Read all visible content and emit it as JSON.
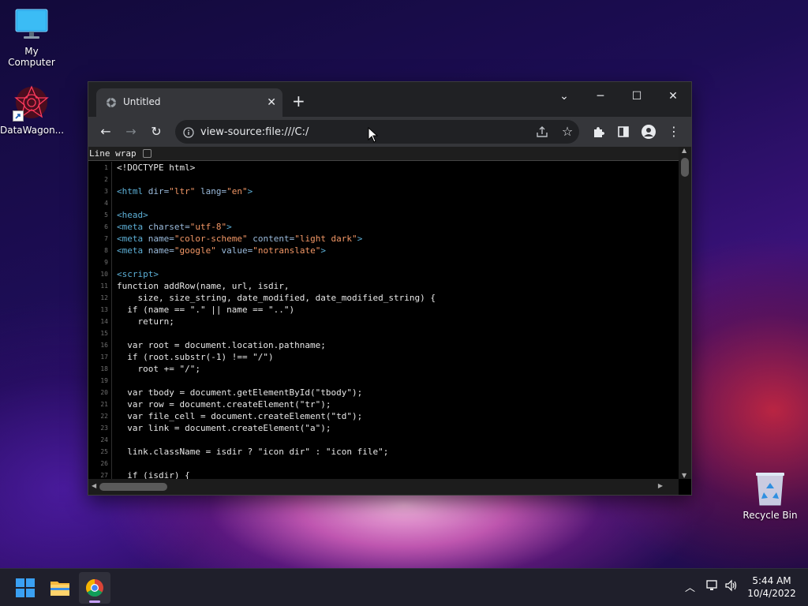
{
  "desktop": {
    "icons": [
      {
        "label": "My Computer",
        "icon": "monitor-icon"
      },
      {
        "label": "DataWagon...",
        "icon": "datawagon-icon"
      },
      {
        "label": "Recycle Bin",
        "icon": "recycle-bin-icon"
      }
    ]
  },
  "browser": {
    "tab": {
      "title": "Untitled",
      "icon": "globe-icon"
    },
    "address_bar": {
      "url": "view-source:file:///C:/"
    },
    "view_source": {
      "line_wrap_label": "Line wrap",
      "line_wrap_checked": false,
      "lines": [
        {
          "n": "1",
          "segments": [
            {
              "t": "<!DOCTYPE html>",
              "c": "plain"
            }
          ]
        },
        {
          "n": "2",
          "segments": []
        },
        {
          "n": "3",
          "segments": [
            {
              "t": "<html ",
              "c": "tag"
            },
            {
              "t": "dir=",
              "c": "attr"
            },
            {
              "t": "\"ltr\"",
              "c": "val"
            },
            {
              "t": " lang=",
              "c": "attr"
            },
            {
              "t": "\"en\"",
              "c": "val"
            },
            {
              "t": ">",
              "c": "tag"
            }
          ]
        },
        {
          "n": "4",
          "segments": []
        },
        {
          "n": "5",
          "segments": [
            {
              "t": "<head>",
              "c": "tag"
            }
          ]
        },
        {
          "n": "6",
          "segments": [
            {
              "t": "<meta ",
              "c": "tag"
            },
            {
              "t": "charset=",
              "c": "attr"
            },
            {
              "t": "\"utf-8\"",
              "c": "val"
            },
            {
              "t": ">",
              "c": "tag"
            }
          ]
        },
        {
          "n": "7",
          "segments": [
            {
              "t": "<meta ",
              "c": "tag"
            },
            {
              "t": "name=",
              "c": "attr"
            },
            {
              "t": "\"color-scheme\"",
              "c": "val"
            },
            {
              "t": " content=",
              "c": "attr"
            },
            {
              "t": "\"light dark\"",
              "c": "val"
            },
            {
              "t": ">",
              "c": "tag"
            }
          ]
        },
        {
          "n": "8",
          "segments": [
            {
              "t": "<meta ",
              "c": "tag"
            },
            {
              "t": "name=",
              "c": "attr"
            },
            {
              "t": "\"google\"",
              "c": "val"
            },
            {
              "t": " value=",
              "c": "attr"
            },
            {
              "t": "\"notranslate\"",
              "c": "val"
            },
            {
              "t": ">",
              "c": "tag"
            }
          ]
        },
        {
          "n": "9",
          "segments": []
        },
        {
          "n": "10",
          "segments": [
            {
              "t": "<script>",
              "c": "tag"
            }
          ]
        },
        {
          "n": "11",
          "segments": [
            {
              "t": "function addRow(name, url, isdir,",
              "c": "plain"
            }
          ]
        },
        {
          "n": "12",
          "segments": [
            {
              "t": "    size, size_string, date_modified, date_modified_string) {",
              "c": "plain"
            }
          ]
        },
        {
          "n": "13",
          "segments": [
            {
              "t": "  if (name == \".\" || name == \"..\")",
              "c": "plain"
            }
          ]
        },
        {
          "n": "14",
          "segments": [
            {
              "t": "    return;",
              "c": "plain"
            }
          ]
        },
        {
          "n": "15",
          "segments": []
        },
        {
          "n": "16",
          "segments": [
            {
              "t": "  var root = document.location.pathname;",
              "c": "plain"
            }
          ]
        },
        {
          "n": "17",
          "segments": [
            {
              "t": "  if (root.substr(-1) !== \"/\")",
              "c": "plain"
            }
          ]
        },
        {
          "n": "18",
          "segments": [
            {
              "t": "    root += \"/\";",
              "c": "plain"
            }
          ]
        },
        {
          "n": "19",
          "segments": []
        },
        {
          "n": "20",
          "segments": [
            {
              "t": "  var tbody = document.getElementById(\"tbody\");",
              "c": "plain"
            }
          ]
        },
        {
          "n": "21",
          "segments": [
            {
              "t": "  var row = document.createElement(\"tr\");",
              "c": "plain"
            }
          ]
        },
        {
          "n": "22",
          "segments": [
            {
              "t": "  var file_cell = document.createElement(\"td\");",
              "c": "plain"
            }
          ]
        },
        {
          "n": "23",
          "segments": [
            {
              "t": "  var link = document.createElement(\"a\");",
              "c": "plain"
            }
          ]
        },
        {
          "n": "24",
          "segments": []
        },
        {
          "n": "25",
          "segments": [
            {
              "t": "  link.className = isdir ? \"icon dir\" : \"icon file\";",
              "c": "plain"
            }
          ]
        },
        {
          "n": "26",
          "segments": []
        },
        {
          "n": "27",
          "segments": [
            {
              "t": "  if (isdir) {",
              "c": "plain"
            }
          ]
        }
      ]
    }
  },
  "taskbar": {
    "apps": [
      {
        "name": "start",
        "icon": "windows-start-icon"
      },
      {
        "name": "file-explorer",
        "icon": "folder-icon"
      },
      {
        "name": "chrome",
        "icon": "chrome-icon",
        "active": true
      }
    ],
    "clock": {
      "time": "5:44 AM",
      "date": "10/4/2022"
    }
  },
  "colors": {
    "tag": "#5db0d7",
    "attr": "#9bbbdc",
    "val": "#f29766",
    "plain": "#e8e8e8"
  }
}
